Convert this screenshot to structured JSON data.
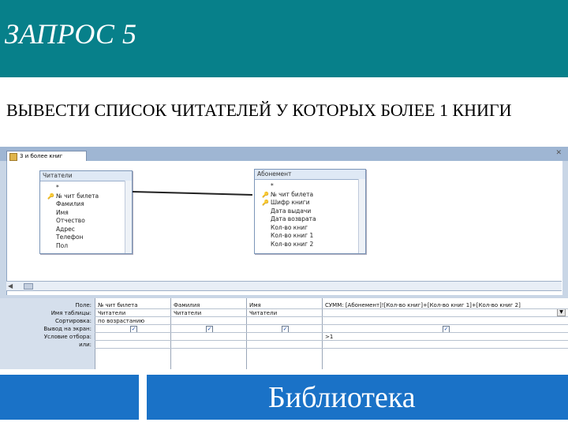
{
  "slide": {
    "title": "ЗАПРОС 5",
    "subtitle": "ВЫВЕСТИ СПИСОК ЧИТАТЕЛЕЙ У КОТОРЫХ БОЛЕЕ 1 КНИГИ",
    "footer": "Библиотека",
    "accent_color": "#07808a",
    "footer_color": "#1a72c7"
  },
  "query_window": {
    "tab_label": "3 и более книг",
    "tables": [
      {
        "name": "Читатели",
        "fields": [
          {
            "label": "*",
            "key": false
          },
          {
            "label": "№ чит билета",
            "key": true
          },
          {
            "label": "Фамилия",
            "key": false
          },
          {
            "label": "Имя",
            "key": false
          },
          {
            "label": "Отчество",
            "key": false
          },
          {
            "label": "Адрес",
            "key": false
          },
          {
            "label": "Телефон",
            "key": false
          },
          {
            "label": "Пол",
            "key": false
          }
        ]
      },
      {
        "name": "Абонемент",
        "fields": [
          {
            "label": "*",
            "key": false
          },
          {
            "label": "№ чит билета",
            "key": true
          },
          {
            "label": "Шифр книги",
            "key": true
          },
          {
            "label": "Дата выдачи",
            "key": false
          },
          {
            "label": "Дата возврата",
            "key": false
          },
          {
            "label": "Кол-во книг",
            "key": false
          },
          {
            "label": "Кол-во книг 1",
            "key": false
          },
          {
            "label": "Кол-во книг 2",
            "key": false
          }
        ]
      }
    ],
    "grid": {
      "row_headers": [
        "Поле:",
        "Имя таблицы:",
        "Сортировка:",
        "Вывод на экран:",
        "Условие отбора:",
        "или:"
      ],
      "columns": [
        {
          "field": "№ чит билета",
          "table": "Читатели",
          "sort": "по возрастанию",
          "show": true,
          "criteria": ""
        },
        {
          "field": "Фамилия",
          "table": "Читатели",
          "sort": "",
          "show": true,
          "criteria": ""
        },
        {
          "field": "Имя",
          "table": "Читатели",
          "sort": "",
          "show": true,
          "criteria": ""
        },
        {
          "field": "СУММ: [Абонемент]![Кол-во книг]+[Кол-во книг 1]+[Кол-во книг 2]",
          "table": "",
          "sort": "",
          "show": true,
          "criteria": ">1"
        }
      ]
    }
  }
}
